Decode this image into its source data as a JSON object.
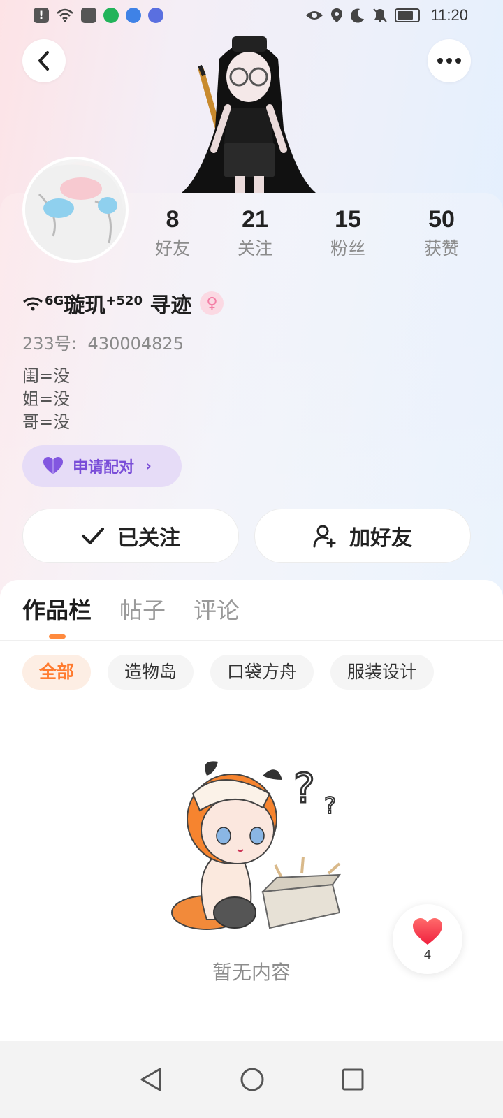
{
  "status_bar": {
    "time": "11:20",
    "left_icons": [
      "alert-icon",
      "wifi-icon",
      "shopping-bag-icon",
      "video-app-icon",
      "browser-icon",
      "music-icon"
    ],
    "right_icons": [
      "eye-icon",
      "location-icon",
      "moon-icon",
      "bell-off-icon",
      "battery-icon"
    ]
  },
  "header": {
    "back_icon": "chevron-left-icon",
    "more_icon": "more-dots-icon"
  },
  "stats": [
    {
      "value": "8",
      "label": "好友"
    },
    {
      "value": "21",
      "label": "关注"
    },
    {
      "value": "15",
      "label": "粉丝"
    },
    {
      "value": "50",
      "label": "获赞"
    }
  ],
  "profile": {
    "nickname_prefix": "6G",
    "nickname_main": "璇玑",
    "nickname_sup": "+520",
    "nickname_suffix": " 寻迹",
    "gender_symbol": "♀",
    "id_label": "233号:",
    "id_value": "430004825",
    "bio_lines": [
      "闺=没",
      "姐=没",
      "哥=没"
    ]
  },
  "pair_button": {
    "label": "申请配对",
    "chevron": "›"
  },
  "actions": {
    "follow_label": "已关注",
    "add_friend_label": "加好友"
  },
  "tabs": [
    "作品栏",
    "帖子",
    "评论"
  ],
  "filters": [
    "全部",
    "造物岛",
    "口袋方舟",
    "服装设计"
  ],
  "empty_state": {
    "text": "暂无内容"
  },
  "like_button": {
    "count": "4"
  },
  "colors": {
    "accent_orange": "#ff7a2e",
    "pair_purple": "#7a4ed8",
    "like_red": "#ff3b4a"
  }
}
